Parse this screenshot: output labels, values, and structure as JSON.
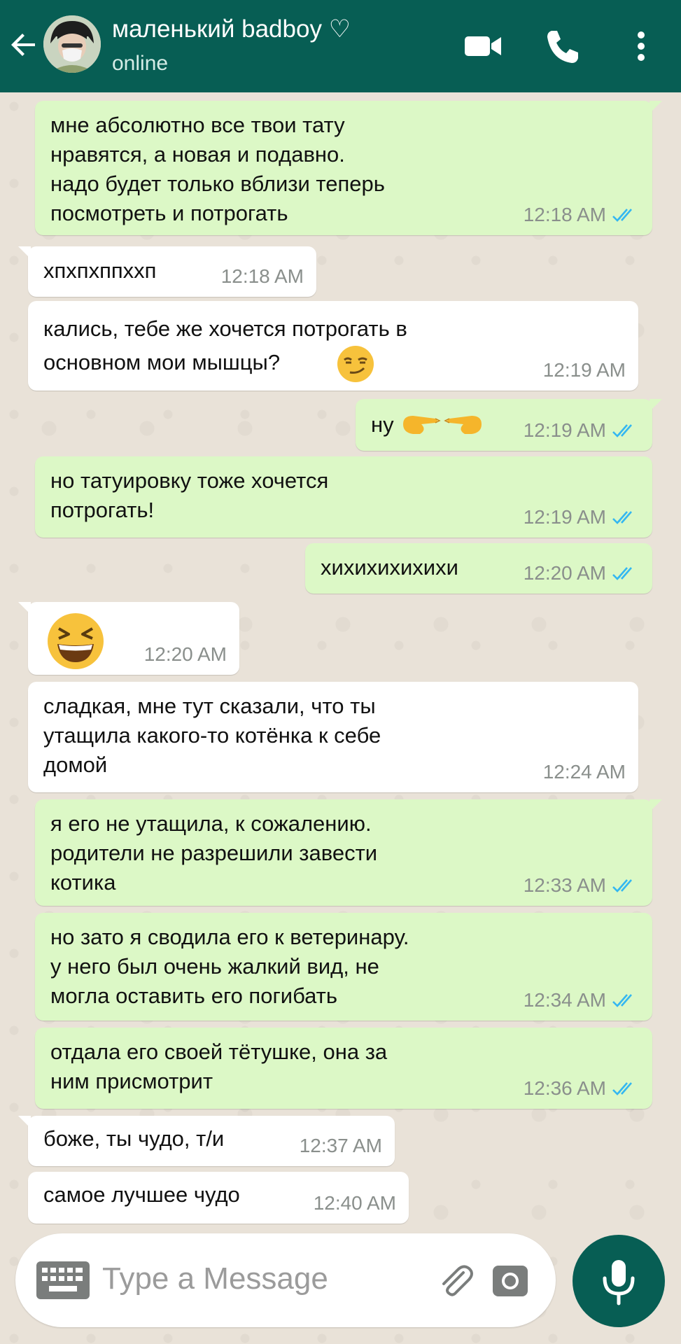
{
  "header": {
    "contact_name": "маленький badboy ♡",
    "status": "online"
  },
  "messages": [
    {
      "dir": "out",
      "text": "мне абсолютно все твои тату\nнравятся, а новая и подавно.\nнадо будет только вблизи теперь\nпосмотреть и потрогать",
      "time": "12:18 AM",
      "read": true
    },
    {
      "dir": "in",
      "text": "хпхпхппххп",
      "time": "12:18 AM"
    },
    {
      "dir": "in",
      "text": "кались, тебе же хочется потрогать в\nосновном мои мышцы?",
      "emoji": "smirk-emoji",
      "time": "12:19 AM"
    },
    {
      "dir": "out",
      "text": "ну",
      "emoji": "pointing-fingers-emoji",
      "time": "12:19 AM",
      "read": true
    },
    {
      "dir": "out",
      "text": "но татуировку тоже хочется\nпотрогать!",
      "time": "12:19 AM",
      "read": true
    },
    {
      "dir": "out",
      "text": "хихихихихихи",
      "time": "12:20 AM",
      "read": true
    },
    {
      "dir": "in",
      "text": "",
      "emoji": "laughing-emoji",
      "time": "12:20 AM"
    },
    {
      "dir": "in",
      "text": "сладкая, мне тут сказали, что ты\nутащила какого-то котёнка к себе\nдомой",
      "time": "12:24 AM"
    },
    {
      "dir": "out",
      "text": "я его не утащила, к сожалению.\nродители не разрешили завести\nкотика",
      "time": "12:33 AM",
      "read": true
    },
    {
      "dir": "out",
      "text": "но зато я сводила его к ветеринару.\nу него был очень жалкий вид, не\nмогла оставить его погибать",
      "time": "12:34 AM",
      "read": true
    },
    {
      "dir": "out",
      "text": "отдала его своей тётушке, она за\nним присмотрит",
      "time": "12:36 AM",
      "read": true
    },
    {
      "dir": "in",
      "text": "боже, ты чудо, т/и",
      "time": "12:37 AM"
    },
    {
      "dir": "in",
      "text": "самое лучшее чудо",
      "time": "12:40 AM"
    }
  ],
  "composer": {
    "placeholder": "Type a Message"
  },
  "colors": {
    "header": "#075e54",
    "outgoing_bubble": "#dcf8c6",
    "incoming_bubble": "#ffffff",
    "read_ticks": "#34b7f1"
  },
  "icons": [
    "back-arrow-icon",
    "video-call-icon",
    "phone-icon",
    "more-options-icon",
    "keyboard-icon",
    "attach-icon",
    "camera-icon",
    "mic-icon"
  ]
}
